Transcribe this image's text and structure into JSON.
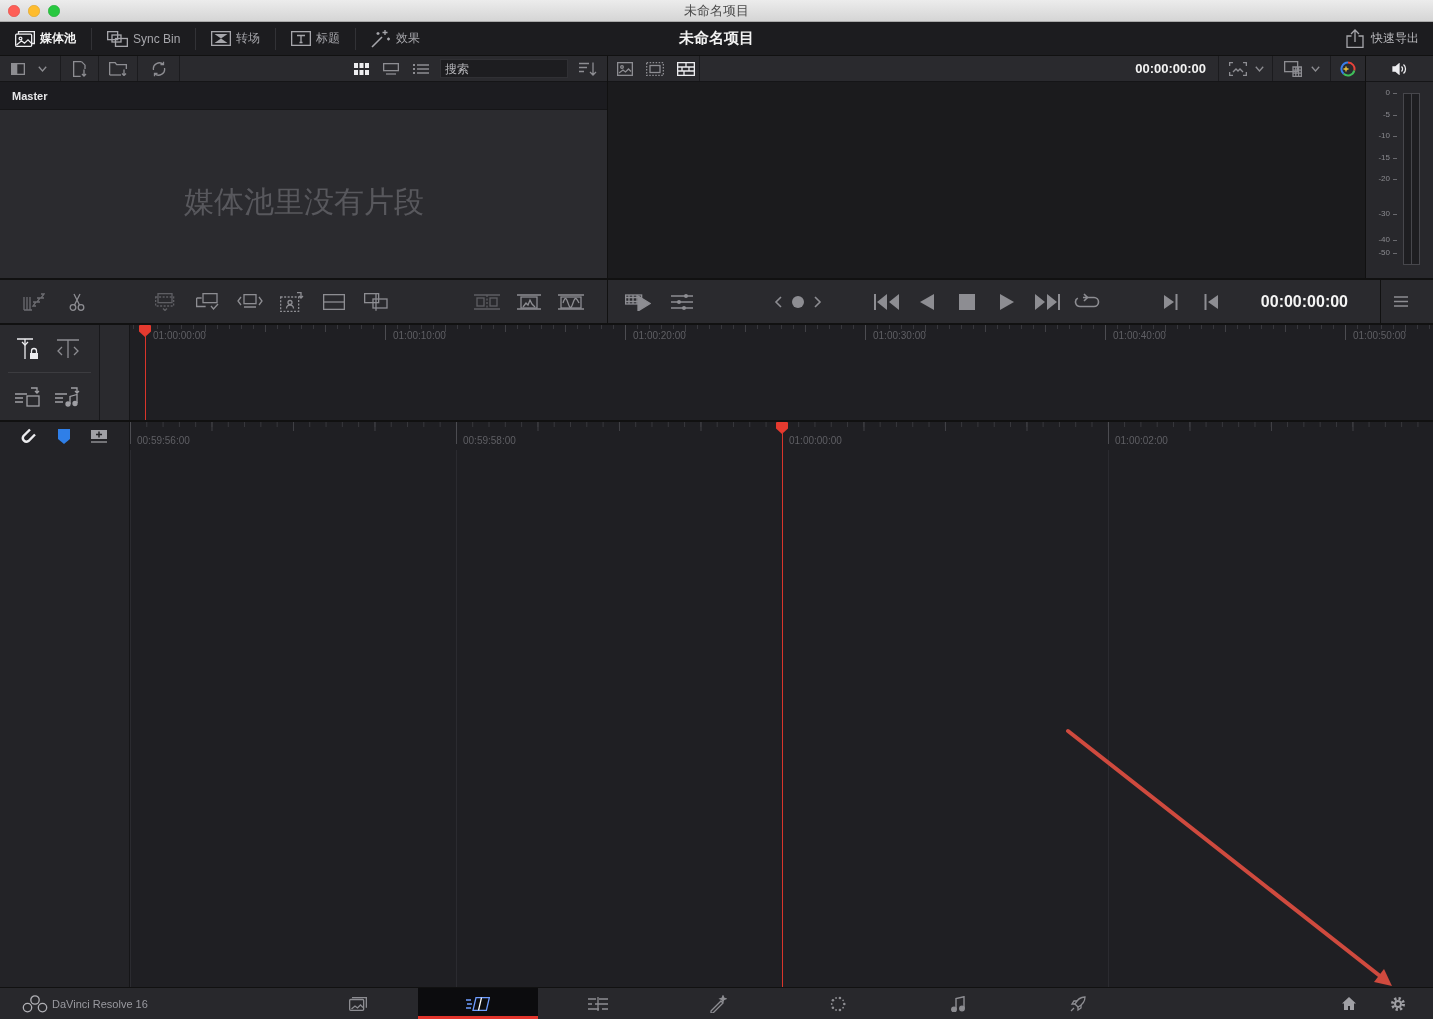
{
  "window": {
    "title": "未命名项目"
  },
  "toolbar": {
    "panels": [
      {
        "kind": "media",
        "label": "媒体池",
        "selected": true
      },
      {
        "kind": "sync",
        "label": "Sync Bin",
        "selected": false
      },
      {
        "kind": "transitions",
        "label": "转场",
        "selected": false
      },
      {
        "kind": "titles",
        "label": "标题",
        "selected": false
      },
      {
        "kind": "effects",
        "label": "效果",
        "selected": false
      }
    ],
    "title": "未命名项目",
    "quick_export": "快速导出"
  },
  "media_pool": {
    "view_modes": [
      {
        "kind": "grid",
        "selected": true
      },
      {
        "kind": "strip",
        "selected": false
      },
      {
        "kind": "list",
        "selected": false
      }
    ],
    "search": {
      "placeholder": "搜索"
    },
    "bin": "Master",
    "empty_message": "媒体池里没有片段"
  },
  "viewer": {
    "modes": [
      {
        "kind": "source",
        "selected": false
      },
      {
        "kind": "tape",
        "selected": false
      },
      {
        "kind": "timeline",
        "selected": true
      }
    ],
    "timecode": "00:00:00:00"
  },
  "audio_meter": {
    "scale": [
      "0",
      "-5",
      "-10",
      "-15",
      "-20",
      "-30",
      "-40",
      "-50"
    ]
  },
  "transport": {
    "timecode": "00:00:00:00"
  },
  "upper_timeline": {
    "ruler": [
      {
        "label": "01:00:00:00",
        "playhead": true
      },
      {
        "label": "01:00:10:00",
        "playhead": false
      },
      {
        "label": "01:00:20:00",
        "playhead": false
      },
      {
        "label": "01:00:30:00",
        "playhead": false
      },
      {
        "label": "01:00:40:00",
        "playhead": false
      },
      {
        "label": "01:00:50:00",
        "playhead": false
      }
    ]
  },
  "timeline": {
    "ruler": [
      {
        "label": "00:59:56:00",
        "playhead": false
      },
      {
        "label": "00:59:58:00",
        "playhead": false
      },
      {
        "label": "01:00:00:00",
        "playhead": true
      },
      {
        "label": "01:00:02:00",
        "playhead": false
      }
    ]
  },
  "pages": [
    {
      "kind": "media",
      "selected": false
    },
    {
      "kind": "cut",
      "selected": true
    },
    {
      "kind": "edit",
      "selected": false
    },
    {
      "kind": "fusion",
      "selected": false
    },
    {
      "kind": "color",
      "selected": false
    },
    {
      "kind": "fairlight",
      "selected": false
    },
    {
      "kind": "deliver",
      "selected": false
    }
  ],
  "app_name": "DaVinci Resolve 16",
  "annotation": {
    "kind": "arrow"
  }
}
